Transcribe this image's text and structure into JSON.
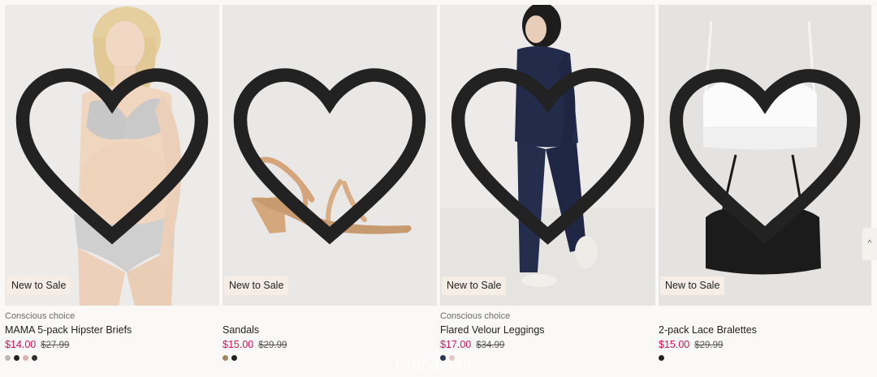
{
  "products": [
    {
      "conscious": "Conscious choice",
      "title": "MAMA 5-pack Hipster Briefs",
      "sale_price": "$14.00",
      "original_price": "$27.99",
      "badge": "New to Sale",
      "swatches": [
        "#b7b7b7",
        "#222222",
        "#d9b3b0",
        "#333333"
      ]
    },
    {
      "conscious": "",
      "title": "Sandals",
      "sale_price": "$15.00",
      "original_price": "$29.99",
      "badge": "New to Sale",
      "swatches": [
        "#a08563",
        "#222222"
      ]
    },
    {
      "conscious": "Conscious choice",
      "title": "Flared Velour Leggings",
      "sale_price": "$17.00",
      "original_price": "$34.99",
      "badge": "New to Sale",
      "swatches": [
        "#2a3350",
        "#e5c8c4"
      ]
    },
    {
      "conscious": "",
      "title": "2-pack Lace Bralettes",
      "sale_price": "$15.00",
      "original_price": "$29.99",
      "badge": "New to Sale",
      "swatches": [
        "#222222"
      ]
    }
  ],
  "scroll_tab_icon": "chevron-up-icon",
  "watermark": "Chinaman",
  "colors": {
    "sale": "#d4145a",
    "badge_bg": "#f5ede6",
    "page_bg": "#faf9f8"
  }
}
